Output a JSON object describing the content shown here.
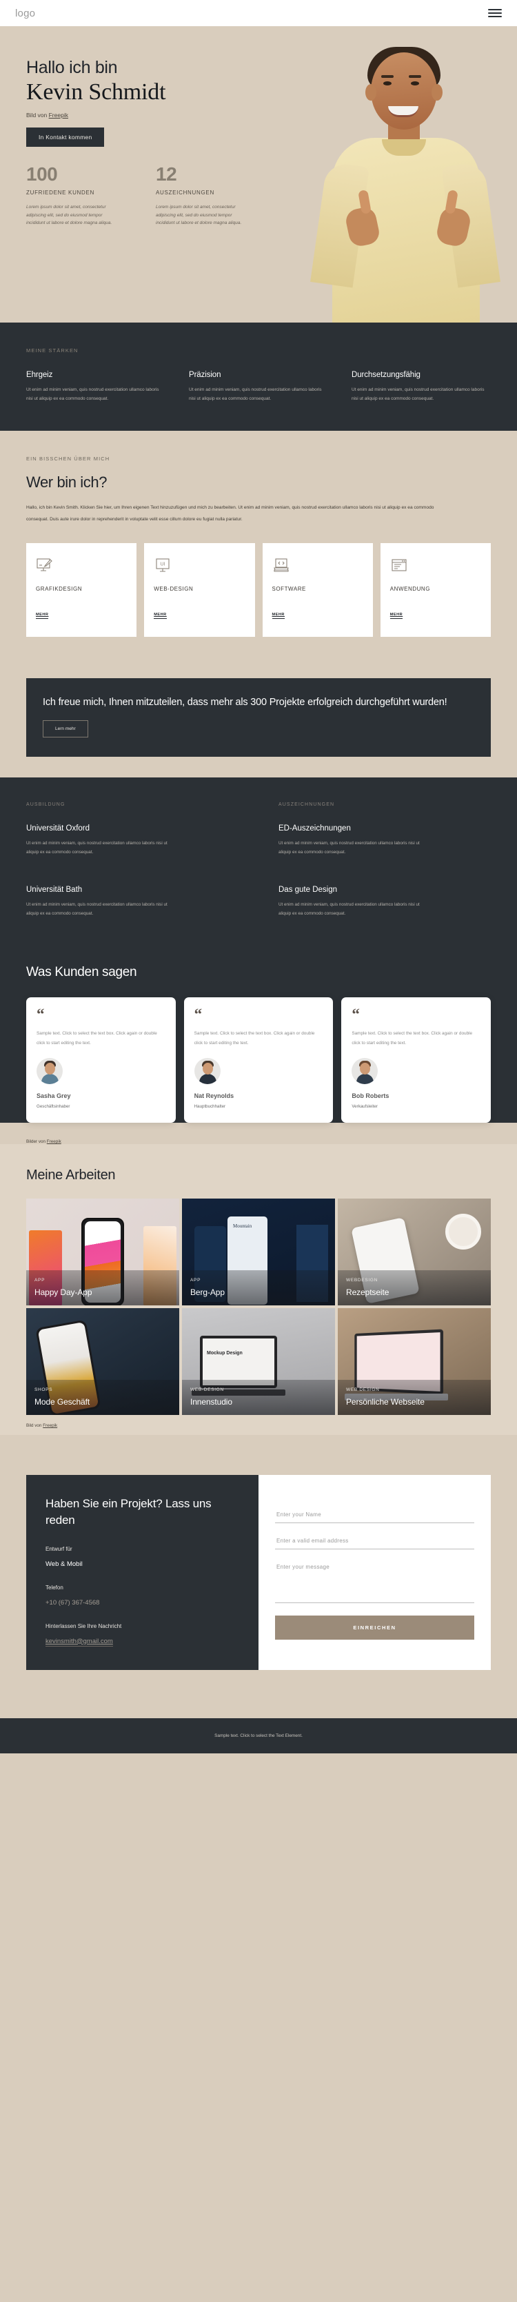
{
  "navbar": {
    "logo": "logo",
    "menu_icon": "hamburger-menu-icon"
  },
  "hero": {
    "greeting": "Hallo ich bin",
    "name": "Kevin Schmidt",
    "credit_prefix": "Bild von ",
    "credit_link": "Freepik",
    "cta_label": "In Kontakt kommen",
    "stats": [
      {
        "number": "100",
        "label": "ZUFRIEDENE KUNDEN",
        "desc": "Lorem ipsum dolor sit amet, consectetur adipiscing elit, sed do eiusmod tempor incididunt ut labore et dolore magna aliqua."
      },
      {
        "number": "12",
        "label": "AUSZEICHNUNGEN",
        "desc": "Lorem ipsum dolor sit amet, consectetur adipiscing elit, sed do eiusmod tempor incididunt ut labore et dolore magna aliqua."
      }
    ]
  },
  "strengths": {
    "eyebrow": "MEINE STÄRKEN",
    "items": [
      {
        "title": "Ehrgeiz",
        "text": "Ut enim ad minim veniam, quis nostrud exercitation ullamco laboris nisi ut aliquip ex ea commodo consequat."
      },
      {
        "title": "Präzision",
        "text": "Ut enim ad minim veniam, quis nostrud exercitation ullamco laboris nisi ut aliquip ex ea commodo consequat."
      },
      {
        "title": "Durchsetzungsfähig",
        "text": "Ut enim ad minim veniam, quis nostrud exercitation ullamco laboris nisi ut aliquip ex ea commodo consequat."
      }
    ]
  },
  "about": {
    "eyebrow": "EIN BISSCHEN ÜBER MICH",
    "title": "Wer bin ich?",
    "text": "Hallo, ich bin Kevin Smith. Klicken Sie hier, um Ihren eigenen Text hinzuzufügen und mich zu bearbeiten. Ut enim ad minim veniam, quis nostrud exercitation ullamco laboris nisi ut aliquip ex ea commodo consequat. Duis aute irure dolor in reprehenderit in voluptate velit esse cillum dolore eu fugiat nulla pariatur.",
    "cards": [
      {
        "icon": "graphic-design-icon",
        "title": "GRAFIKDESIGN",
        "more": "MEHR"
      },
      {
        "icon": "ui-monitor-icon",
        "title": "WEB-DESIGN",
        "more": "MEHR"
      },
      {
        "icon": "code-laptop-icon",
        "title": "SOFTWARE",
        "more": "MEHR"
      },
      {
        "icon": "browser-window-icon",
        "title": "ANWENDUNG",
        "more": "MEHR"
      }
    ]
  },
  "cta_banner": {
    "title": "Ich freue mich, Ihnen mitzuteilen, dass mehr als 300 Projekte erfolgreich durchgeführt wurden!",
    "button": "Lern mehr"
  },
  "education": {
    "left_eyebrow": "AUSBILDUNG",
    "right_eyebrow": "AUSZEICHNUNGEN",
    "left_items": [
      {
        "title": "Universität Oxford",
        "text": "Ut enim ad minim veniam, quis nostrud exercitation ullamco laboris nisi ut aliquip ex ea commodo consequat."
      },
      {
        "title": "Universität Bath",
        "text": "Ut enim ad minim veniam, quis nostrud exercitation ullamco laboris nisi ut aliquip ex ea commodo consequat."
      }
    ],
    "right_items": [
      {
        "title": "ED-Auszeichnungen",
        "text": "Ut enim ad minim veniam, quis nostrud exercitation ullamco laboris nisi ut aliquip ex ea commodo consequat."
      },
      {
        "title": "Das gute Design",
        "text": "Ut enim ad minim veniam, quis nostrud exercitation ullamco laboris nisi ut aliquip ex ea commodo consequat."
      }
    ]
  },
  "testimonials": {
    "title": "Was Kunden sagen",
    "credit_prefix": "Bilder von ",
    "credit_link": "Freepik",
    "items": [
      {
        "quote_mark": "“",
        "text": "Sample text. Click to select the text box. Click again or double click to start editing the text.",
        "name": "Sasha Grey",
        "role": "Geschäftsinhaber"
      },
      {
        "quote_mark": "“",
        "text": "Sample text. Click to select the text box. Click again or double click to start editing the text.",
        "name": "Nat Reynolds",
        "role": "Hauptbuchhalter"
      },
      {
        "quote_mark": "“",
        "text": "Sample text. Click to select the text box. Click again or double click to start editing the text.",
        "name": "Bob Roberts",
        "role": "Verkaufsleiter"
      }
    ]
  },
  "portfolio": {
    "title": "Meine Arbeiten",
    "credit_prefix": "Bild von ",
    "credit_link": "Freepik",
    "items": [
      {
        "category": "APP",
        "name": "Happy Day-App"
      },
      {
        "category": "APP",
        "name": "Berg-App"
      },
      {
        "category": "WEBDESIGN",
        "name": "Rezeptseite"
      },
      {
        "category": "SHOPS",
        "name": "Mode Geschäft"
      },
      {
        "category": "WEB-DESIGN",
        "name": "Innenstudio"
      },
      {
        "category": "WEB DESIGN",
        "name": "Persönliche Webseite"
      }
    ]
  },
  "contact": {
    "title": "Haben Sie ein Projekt? Lass uns reden",
    "design_for_label": "Entwurf für",
    "design_for_value": "Web & Mobil",
    "phone_label": "Telefon",
    "phone_value": "+10 (67) 367-4568",
    "message_label": "Hinterlassen Sie Ihre Nachricht",
    "email_value": "kevinsmith@gmail.com",
    "name_placeholder": "Enter your Name",
    "email_placeholder": "Enter a valid email address",
    "message_placeholder": "Enter your message",
    "submit_label": "EINREICHEN"
  },
  "footer": {
    "text": "Sample text. Click to select the Text Element."
  },
  "colors": {
    "accent": "#9b8b79",
    "dark": "#2b3035",
    "beige": "#d9cdbd"
  }
}
